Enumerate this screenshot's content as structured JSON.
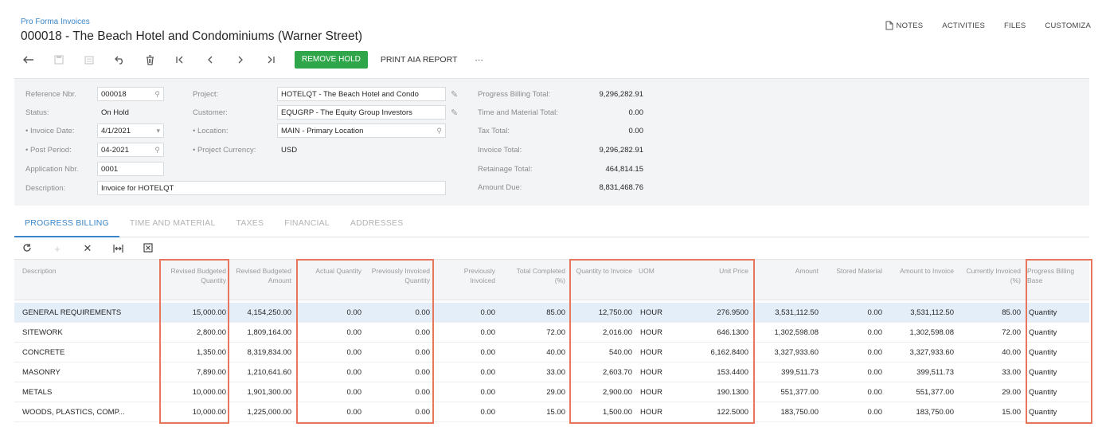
{
  "header": {
    "breadcrumb": "Pro Forma Invoices",
    "title": "000018 - The Beach Hotel and Condominiums (Warner Street)",
    "actions": [
      "NOTES",
      "ACTIVITIES",
      "FILES",
      "CUSTOMIZA"
    ]
  },
  "toolbar": {
    "remove_hold": "REMOVE HOLD",
    "print_aia": "PRINT AIA REPORT",
    "more": "···"
  },
  "form": {
    "reference_nbr": {
      "label": "Reference Nbr.",
      "value": "000018"
    },
    "status": {
      "label": "Status:",
      "value": "On Hold"
    },
    "invoice_date": {
      "label": "• Invoice Date:",
      "value": "4/1/2021"
    },
    "post_period": {
      "label": "• Post Period:",
      "value": "04-2021"
    },
    "application_nbr": {
      "label": "Application Nbr.",
      "value": "0001"
    },
    "description": {
      "label": "Description:",
      "value": "Invoice for HOTELQT"
    },
    "project": {
      "label": "Project:",
      "value": "HOTELQT - The Beach Hotel and Condo"
    },
    "customer": {
      "label": "Customer:",
      "value": "EQUGRP - The Equity Group Investors"
    },
    "location": {
      "label": "• Location:",
      "value": "MAIN - Primary Location"
    },
    "project_currency": {
      "label": "• Project Currency:",
      "value": "USD"
    },
    "totals": [
      {
        "label": "Progress Billing Total:",
        "value": "9,296,282.91"
      },
      {
        "label": "Time and Material Total:",
        "value": "0.00"
      },
      {
        "label": "Tax Total:",
        "value": "0.00"
      },
      {
        "label": "Invoice Total:",
        "value": "9,296,282.91"
      },
      {
        "label": "Retainage Total:",
        "value": "464,814.15"
      },
      {
        "label": "Amount Due:",
        "value": "8,831,468.76"
      }
    ]
  },
  "tabs": [
    "PROGRESS BILLING",
    "TIME AND MATERIAL",
    "TAXES",
    "FINANCIAL",
    "ADDRESSES"
  ],
  "grid": {
    "headers": {
      "description": "Description",
      "revised_qty": "Revised Budgeted Quantity",
      "revised_amt": "Revised Budgeted Amount",
      "actual_qty": "Actual Quantity",
      "prev_inv_qty": "Previously Invoiced Quantity",
      "prev_invoiced": "Previously Invoiced",
      "total_completed": "Total Completed (%)",
      "qty_to_invoice": "Quantity to Invoice",
      "uom": "UOM",
      "unit_price": "Unit Price",
      "amount": "Amount",
      "stored_material": "Stored Material",
      "amount_to_invoice": "Amount to Invoice",
      "currently_invoiced": "Currently Invoiced (%)",
      "billing_base": "Progress Billing Base"
    },
    "rows": [
      {
        "description": "GENERAL REQUIREMENTS",
        "revised_qty": "15,000.00",
        "revised_amt": "4,154,250.00",
        "actual_qty": "0.00",
        "prev_inv_qty": "0.00",
        "prev_invoiced": "0.00",
        "total_completed": "85.00",
        "qty_to_invoice": "12,750.00",
        "uom": "HOUR",
        "unit_price": "276.9500",
        "amount": "3,531,112.50",
        "stored_material": "0.00",
        "amount_to_invoice": "3,531,112.50",
        "currently_invoiced": "85.00",
        "billing_base": "Quantity"
      },
      {
        "description": "SITEWORK",
        "revised_qty": "2,800.00",
        "revised_amt": "1,809,164.00",
        "actual_qty": "0.00",
        "prev_inv_qty": "0.00",
        "prev_invoiced": "0.00",
        "total_completed": "72.00",
        "qty_to_invoice": "2,016.00",
        "uom": "HOUR",
        "unit_price": "646.1300",
        "amount": "1,302,598.08",
        "stored_material": "0.00",
        "amount_to_invoice": "1,302,598.08",
        "currently_invoiced": "72.00",
        "billing_base": "Quantity"
      },
      {
        "description": "CONCRETE",
        "revised_qty": "1,350.00",
        "revised_amt": "8,319,834.00",
        "actual_qty": "0.00",
        "prev_inv_qty": "0.00",
        "prev_invoiced": "0.00",
        "total_completed": "40.00",
        "qty_to_invoice": "540.00",
        "uom": "HOUR",
        "unit_price": "6,162.8400",
        "amount": "3,327,933.60",
        "stored_material": "0.00",
        "amount_to_invoice": "3,327,933.60",
        "currently_invoiced": "40.00",
        "billing_base": "Quantity"
      },
      {
        "description": "MASONRY",
        "revised_qty": "7,890.00",
        "revised_amt": "1,210,641.60",
        "actual_qty": "0.00",
        "prev_inv_qty": "0.00",
        "prev_invoiced": "0.00",
        "total_completed": "33.00",
        "qty_to_invoice": "2,603.70",
        "uom": "HOUR",
        "unit_price": "153.4400",
        "amount": "399,511.73",
        "stored_material": "0.00",
        "amount_to_invoice": "399,511.73",
        "currently_invoiced": "33.00",
        "billing_base": "Quantity"
      },
      {
        "description": "METALS",
        "revised_qty": "10,000.00",
        "revised_amt": "1,901,300.00",
        "actual_qty": "0.00",
        "prev_inv_qty": "0.00",
        "prev_invoiced": "0.00",
        "total_completed": "29.00",
        "qty_to_invoice": "2,900.00",
        "uom": "HOUR",
        "unit_price": "190.1300",
        "amount": "551,377.00",
        "stored_material": "0.00",
        "amount_to_invoice": "551,377.00",
        "currently_invoiced": "29.00",
        "billing_base": "Quantity"
      },
      {
        "description": "WOODS, PLASTICS, COMP...",
        "revised_qty": "10,000.00",
        "revised_amt": "1,225,000.00",
        "actual_qty": "0.00",
        "prev_inv_qty": "0.00",
        "prev_invoiced": "0.00",
        "total_completed": "15.00",
        "qty_to_invoice": "1,500.00",
        "uom": "HOUR",
        "unit_price": "122.5000",
        "amount": "183,750.00",
        "stored_material": "0.00",
        "amount_to_invoice": "183,750.00",
        "currently_invoiced": "15.00",
        "billing_base": "Quantity"
      }
    ]
  },
  "colors": {
    "accent": "#3a86c8",
    "primary_button": "#2fa64a",
    "highlight_box": "#e8765c",
    "selected_row": "#e4eef8"
  }
}
